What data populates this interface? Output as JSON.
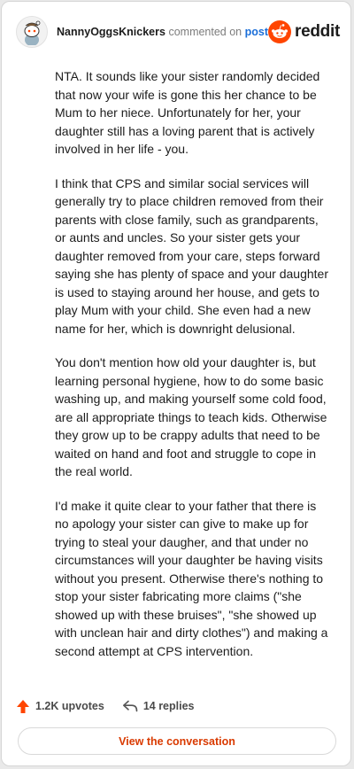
{
  "comment": {
    "username": "NannyOggsKnickers",
    "action_text": "commented on",
    "target_link": "post",
    "paragraphs": [
      "NTA. It sounds like your sister randomly decided that now your wife is gone this her chance to be Mum to her niece. Unfortunately for her, your daughter still has a loving parent that is actively involved in her life - you.",
      "I think that CPS and similar social services will generally try to place children removed from their parents with close family, such as grandparents, or aunts and uncles. So your sister gets your daughter removed from your care, steps forward saying she has plenty of space and your daughter is used to staying around her house, and gets to play Mum with your child. She even had a new name for her, which is downright delusional.",
      "You don't mention how old your daughter is, but learning personal hygiene, how to do some basic washing up, and making yourself some cold food, are all appropriate things to teach kids. Otherwise they grow up to be crappy adults that need to be waited on hand and foot and struggle to cope in the real world.",
      "I'd make it quite clear to your father that there is no apology your sister can give to make up for trying to steal your daugher, and that under no circumstances will your daughter be having visits without you present. Otherwise there's nothing to stop your sister fabricating more claims (\"she showed up with these bruises\", \"she showed up with unclean hair and dirty clothes\") and making a second attempt at CPS intervention."
    ],
    "upvotes": "1.2K upvotes",
    "replies": "14 replies"
  },
  "brand": {
    "name": "reddit",
    "color": "#ff4500"
  },
  "actions": {
    "view_conversation": "View the conversation"
  },
  "colors": {
    "upvote_accent": "#ff4500",
    "link": "#1a6ed8",
    "cta": "#d93a00"
  },
  "icons": {
    "avatar": "snoo-avatar-icon",
    "logo": "reddit-logo-icon",
    "upvote": "upvote-arrow-icon",
    "reply": "reply-arrow-icon"
  }
}
